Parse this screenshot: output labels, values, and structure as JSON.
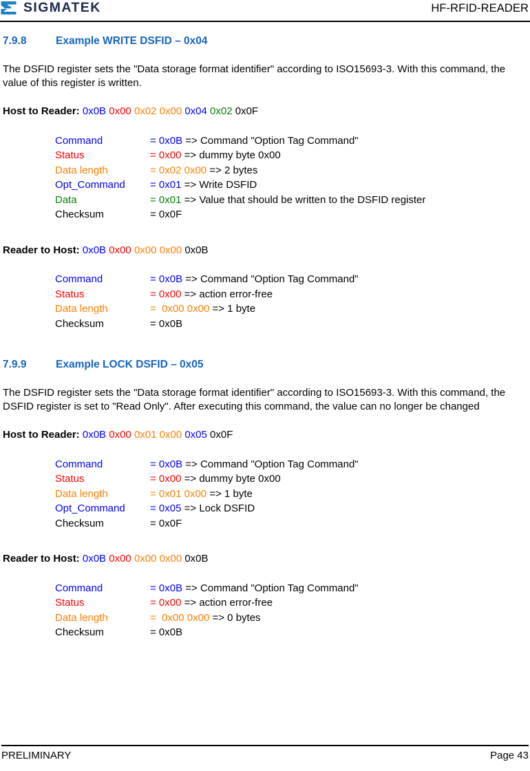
{
  "header": {
    "brand_name": "SIGMATEK",
    "logo_icon": "sigmatek-sigma-logo",
    "doc_title": "HF-RFID-READER",
    "brand_color": "#1c2b4a",
    "logo_color": "#1f7fc4"
  },
  "colors": {
    "heading_blue": "#1565C0",
    "command_blue": "#0000FF",
    "status_red": "#FF0000",
    "datalength_orange": "#FF7F00",
    "data_green": "#008000",
    "plain_black": "#000000"
  },
  "sections": [
    {
      "number": "7.9.8",
      "title": "Example WRITE DSFID – 0x04",
      "paragraph": "The DSFID register sets the \"Data storage format identifier\" according to ISO15693-3. With this command, the value of this register is written.",
      "blocks": [
        {
          "direction_label": "Host to Reader:",
          "frame_bytes": [
            {
              "text": "0x0B",
              "color": "blue"
            },
            {
              "text": "0x00",
              "color": "red"
            },
            {
              "text": "0x02",
              "color": "orange"
            },
            {
              "text": "0x00",
              "color": "orange"
            },
            {
              "text": "0x04",
              "color": "blue"
            },
            {
              "text": "0x02",
              "color": "green"
            },
            {
              "text": "0x0F",
              "color": "black"
            }
          ],
          "rows": [
            {
              "label": "Command",
              "color": "blue",
              "value": "= 0x0B",
              "desc": " => Command \"Option Tag Command\""
            },
            {
              "label": "Status",
              "color": "red",
              "value": "= 0x00",
              "desc": " => dummy byte 0x00"
            },
            {
              "label": "Data length",
              "color": "orange",
              "value": "= 0x02 0x00",
              "desc": " => 2 bytes"
            },
            {
              "label": "Opt_Command",
              "color": "blue",
              "value": "= 0x01",
              "desc": " => Write DSFID"
            },
            {
              "label": "Data",
              "color": "green",
              "value": "= 0x01",
              "desc": " => Value that should be written to the DSFID register"
            },
            {
              "label": "Checksum",
              "color": "black",
              "value": "= 0x0F",
              "desc": ""
            }
          ]
        },
        {
          "direction_label": "Reader to Host:",
          "frame_bytes": [
            {
              "text": "0x0B",
              "color": "blue"
            },
            {
              "text": "0x00",
              "color": "red"
            },
            {
              "text": "0x00",
              "color": "orange"
            },
            {
              "text": "0x00",
              "color": "orange"
            },
            {
              "text": "0x0B",
              "color": "black"
            }
          ],
          "rows": [
            {
              "label": "Command",
              "color": "blue",
              "value": "= 0x0B",
              "desc": " => Command \"Option Tag Command\""
            },
            {
              "label": "Status",
              "color": "red",
              "value": "= 0x00",
              "desc": " => action error-free"
            },
            {
              "label": "Data length",
              "color": "orange",
              "value": "=  0x00 0x00",
              "desc": " => 1 byte"
            },
            {
              "label": "Checksum",
              "color": "black",
              "value": "= 0x0B",
              "desc": ""
            }
          ]
        }
      ]
    },
    {
      "number": "7.9.9",
      "title": "Example LOCK DSFID – 0x05",
      "paragraph": "The DSFID register sets the \"Data storage format identifier\" according to ISO15693-3. With this command, the DSFID register is set to \"Read Only\". After executing this command, the value can no longer be changed",
      "blocks": [
        {
          "direction_label": "Host to Reader:",
          "frame_bytes": [
            {
              "text": "0x0B",
              "color": "blue"
            },
            {
              "text": "0x00",
              "color": "red"
            },
            {
              "text": "0x01",
              "color": "orange"
            },
            {
              "text": "0x00",
              "color": "orange"
            },
            {
              "text": "0x05",
              "color": "blue"
            },
            {
              "text": "0x0F",
              "color": "black"
            }
          ],
          "rows": [
            {
              "label": "Command",
              "color": "blue",
              "value": "= 0x0B",
              "desc": " => Command \"Option Tag Command\""
            },
            {
              "label": "Status",
              "color": "red",
              "value": "= 0x00",
              "desc": " => dummy byte 0x00"
            },
            {
              "label": "Data length",
              "color": "orange",
              "value": "= 0x01 0x00",
              "desc": " => 1 byte"
            },
            {
              "label": "Opt_Command",
              "color": "blue",
              "value": "= 0x05",
              "desc": " => Lock DSFID"
            },
            {
              "label": "Checksum",
              "color": "black",
              "value": "= 0x0F",
              "desc": ""
            }
          ]
        },
        {
          "direction_label": "Reader to Host:",
          "frame_bytes": [
            {
              "text": "0x0B",
              "color": "blue"
            },
            {
              "text": "0x00",
              "color": "red"
            },
            {
              "text": "0x00",
              "color": "orange"
            },
            {
              "text": "0x00",
              "color": "orange"
            },
            {
              "text": "0x0B",
              "color": "black"
            }
          ],
          "rows": [
            {
              "label": "Command",
              "color": "blue",
              "value": "= 0x0B",
              "desc": " => Command \"Option Tag Command\""
            },
            {
              "label": "Status",
              "color": "red",
              "value": "= 0x00",
              "desc": " => action error-free"
            },
            {
              "label": "Data length",
              "color": "orange",
              "value": "=  0x00 0x00",
              "desc": " => 0 bytes"
            },
            {
              "label": "Checksum",
              "color": "black",
              "value": "= 0x0B",
              "desc": ""
            }
          ]
        }
      ]
    }
  ],
  "footer": {
    "status": "PRELIMINARY",
    "page": "Page 43"
  }
}
